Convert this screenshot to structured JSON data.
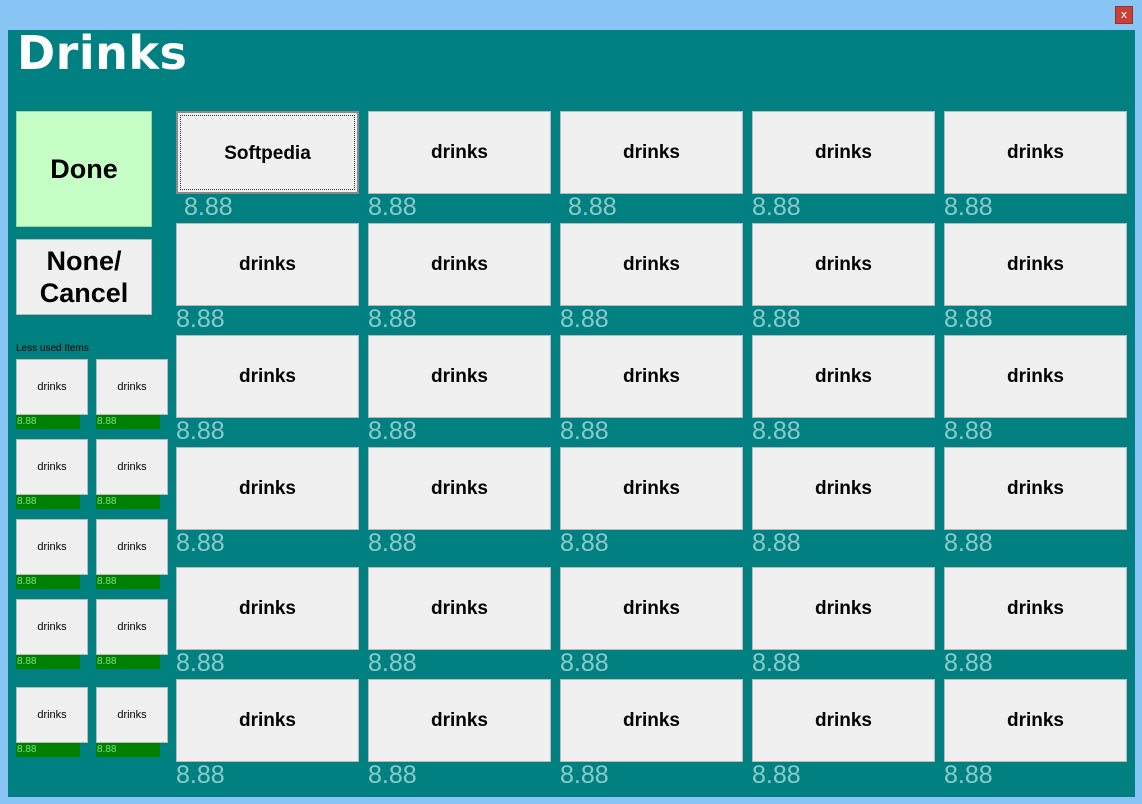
{
  "window": {
    "close_label": "x",
    "title": "Drinks"
  },
  "actions": {
    "done_label": "Done",
    "cancel_line1": "None/",
    "cancel_line2": "Cancel"
  },
  "less_used": {
    "label": "Less used Items",
    "items": [
      {
        "label": "drinks",
        "price": "8.88"
      },
      {
        "label": "drinks",
        "price": "8.88"
      },
      {
        "label": "drinks",
        "price": "8.88"
      },
      {
        "label": "drinks",
        "price": "8.88"
      },
      {
        "label": "drinks",
        "price": "8.88"
      },
      {
        "label": "drinks",
        "price": "8.88"
      },
      {
        "label": "drinks",
        "price": "8.88"
      },
      {
        "label": "drinks",
        "price": "8.88"
      },
      {
        "label": "drinks",
        "price": "8.88"
      },
      {
        "label": "drinks",
        "price": "8.88"
      }
    ]
  },
  "grid": {
    "items": [
      {
        "label": "Softpedia",
        "price": "8.88"
      },
      {
        "label": "drinks",
        "price": "8.88"
      },
      {
        "label": "drinks",
        "price": "8.88"
      },
      {
        "label": "drinks",
        "price": "8.88"
      },
      {
        "label": "drinks",
        "price": "8.88"
      },
      {
        "label": "drinks",
        "price": "8.88"
      },
      {
        "label": "drinks",
        "price": "8.88"
      },
      {
        "label": "drinks",
        "price": "8.88"
      },
      {
        "label": "drinks",
        "price": "8.88"
      },
      {
        "label": "drinks",
        "price": "8.88"
      },
      {
        "label": "drinks",
        "price": "8.88"
      },
      {
        "label": "drinks",
        "price": "8.88"
      },
      {
        "label": "drinks",
        "price": "8.88"
      },
      {
        "label": "drinks",
        "price": "8.88"
      },
      {
        "label": "drinks",
        "price": "8.88"
      },
      {
        "label": "drinks",
        "price": "8.88"
      },
      {
        "label": "drinks",
        "price": "8.88"
      },
      {
        "label": "drinks",
        "price": "8.88"
      },
      {
        "label": "drinks",
        "price": "8.88"
      },
      {
        "label": "drinks",
        "price": "8.88"
      },
      {
        "label": "drinks",
        "price": "8.88"
      },
      {
        "label": "drinks",
        "price": "8.88"
      },
      {
        "label": "drinks",
        "price": "8.88"
      },
      {
        "label": "drinks",
        "price": "8.88"
      },
      {
        "label": "drinks",
        "price": "8.88"
      },
      {
        "label": "drinks",
        "price": "8.88"
      },
      {
        "label": "drinks",
        "price": "8.88"
      },
      {
        "label": "drinks",
        "price": "8.88"
      },
      {
        "label": "drinks",
        "price": "8.88"
      },
      {
        "label": "drinks",
        "price": "8.88"
      }
    ]
  },
  "colors": {
    "window_bg": "#008080",
    "done_bg": "#c6ffc6",
    "price_bar": "#008000",
    "title_bar": "#88c4f4"
  }
}
